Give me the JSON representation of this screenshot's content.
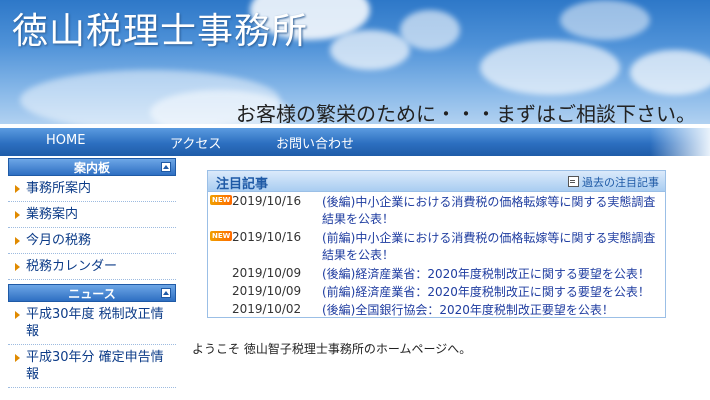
{
  "header": {
    "site_title": "徳山税理士事務所",
    "tagline": "お客様の繁栄のために・・・まずはご相談下さい。"
  },
  "nav": {
    "items": [
      {
        "label": "HOME"
      },
      {
        "label": "アクセス"
      },
      {
        "label": "お問い合わせ"
      }
    ]
  },
  "sidebar": {
    "sections": [
      {
        "title": "案内板",
        "items": [
          {
            "label": "事務所案内"
          },
          {
            "label": "業務案内"
          },
          {
            "label": "今月の税務"
          },
          {
            "label": "税務カレンダー"
          }
        ]
      },
      {
        "title": "ニュース",
        "items": [
          {
            "label": "平成30年度 税制改正情報"
          },
          {
            "label": "平成30年分 確定申告情報"
          }
        ]
      }
    ]
  },
  "featured": {
    "title": "注目記事",
    "archive_label": "過去の注目記事",
    "new_badge": "NEW",
    "articles": [
      {
        "date": "2019/10/16",
        "title": "(後編)中小企業における消費税の価格転嫁等に関する実態調査結果を公表！",
        "is_new": true
      },
      {
        "date": "2019/10/16",
        "title": "(前編)中小企業における消費税の価格転嫁等に関する実態調査結果を公表！",
        "is_new": true
      },
      {
        "date": "2019/10/09",
        "title": "(後編)経済産業省：2020年度税制改正に関する要望を公表！",
        "is_new": false
      },
      {
        "date": "2019/10/09",
        "title": "(前編)経済産業省：2020年度税制改正に関する要望を公表！",
        "is_new": false
      },
      {
        "date": "2019/10/02",
        "title": "(後編)全国銀行協会：2020年度税制改正要望を公表！",
        "is_new": false
      }
    ]
  },
  "main": {
    "welcome": "ようこそ 徳山智子税理士事務所のホームページへ。"
  }
}
